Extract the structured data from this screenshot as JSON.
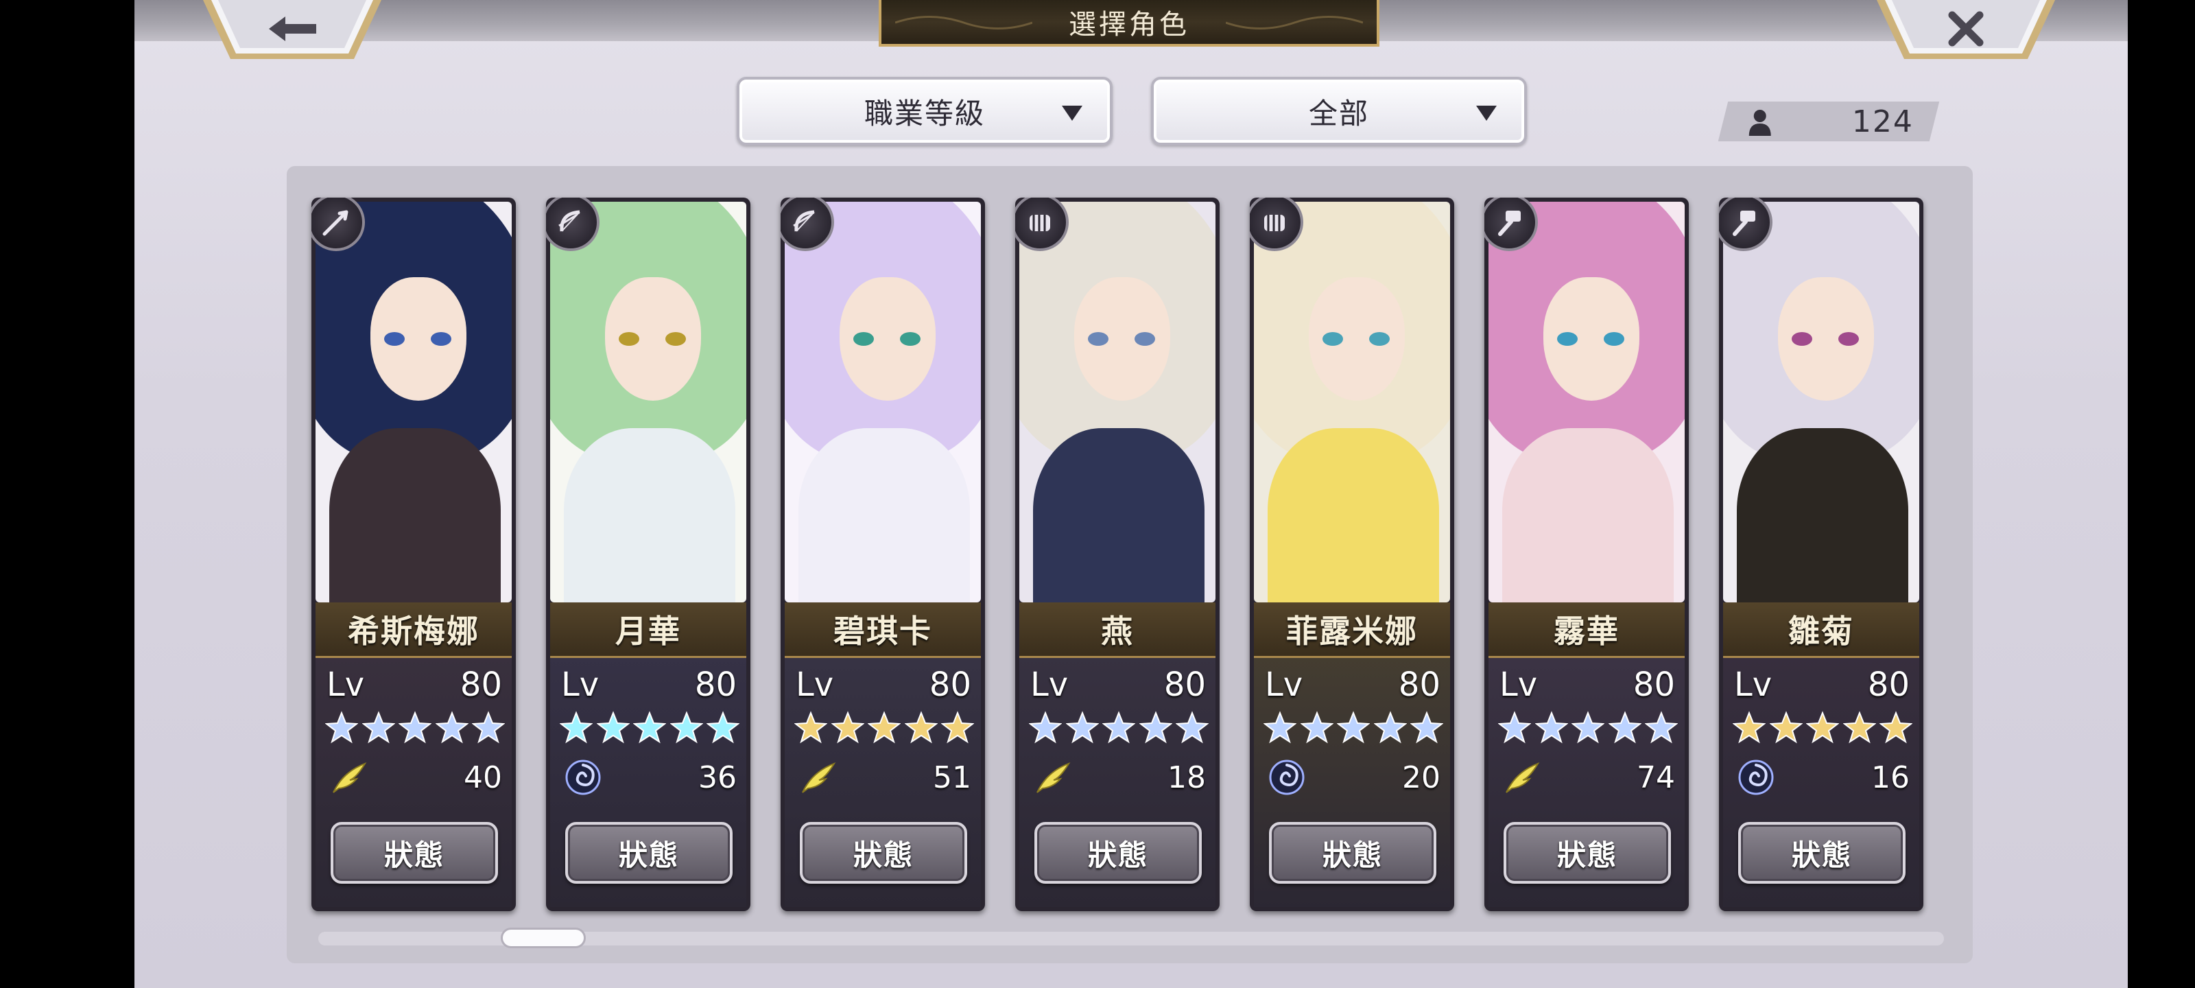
{
  "header": {
    "title": "選擇角色",
    "back_icon": "arrow-left-icon",
    "close_icon": "close-x-icon"
  },
  "filters": {
    "sort": {
      "label": "職業等級"
    },
    "category": {
      "label": "全部"
    }
  },
  "character_count": {
    "icon": "person-icon",
    "value": "124"
  },
  "colors": {
    "gold_trim": "#c9a866",
    "star_silver": "#bcd3ff",
    "star_gold": "#f2d27a",
    "star_cyan": "#9ff3ff",
    "wind_yellow": "#f1e05a",
    "swirl_blue": "#b8c6ff"
  },
  "characters": [
    {
      "name": "希斯梅娜",
      "lv_label": "Lv",
      "level": "80",
      "stars": 5,
      "star_color": "silver",
      "class_icon": "spear-class-icon",
      "element_icon": "wind-feather-icon",
      "element_value": "40",
      "status_label": "狀態"
    },
    {
      "name": "月華",
      "lv_label": "Lv",
      "level": "80",
      "stars": 5,
      "star_color": "cyan",
      "class_icon": "bow-class-icon",
      "element_icon": "swirl-icon",
      "element_value": "36",
      "status_label": "狀態"
    },
    {
      "name": "碧琪卡",
      "lv_label": "Lv",
      "level": "80",
      "stars": 5,
      "star_color": "gold",
      "class_icon": "bow-class-icon",
      "element_icon": "wind-feather-icon",
      "element_value": "51",
      "status_label": "狀態"
    },
    {
      "name": "燕",
      "lv_label": "Lv",
      "level": "80",
      "stars": 5,
      "star_color": "silver",
      "class_icon": "fist-class-icon",
      "element_icon": "wind-feather-icon",
      "element_value": "18",
      "status_label": "狀態"
    },
    {
      "name": "菲露米娜",
      "lv_label": "Lv",
      "level": "80",
      "stars": 5,
      "star_color": "silver",
      "class_icon": "fist-class-icon",
      "element_icon": "swirl-icon",
      "element_value": "20",
      "status_label": "狀態"
    },
    {
      "name": "霧華",
      "lv_label": "Lv",
      "level": "80",
      "stars": 5,
      "star_color": "silver",
      "class_icon": "hammer-class-icon",
      "element_icon": "wind-feather-icon",
      "element_value": "74",
      "status_label": "狀態"
    },
    {
      "name": "雛菊",
      "lv_label": "Lv",
      "level": "80",
      "stars": 5,
      "star_color": "gold",
      "class_icon": "hammer-class-icon",
      "element_icon": "swirl-icon",
      "element_value": "16",
      "status_label": "狀態"
    }
  ]
}
